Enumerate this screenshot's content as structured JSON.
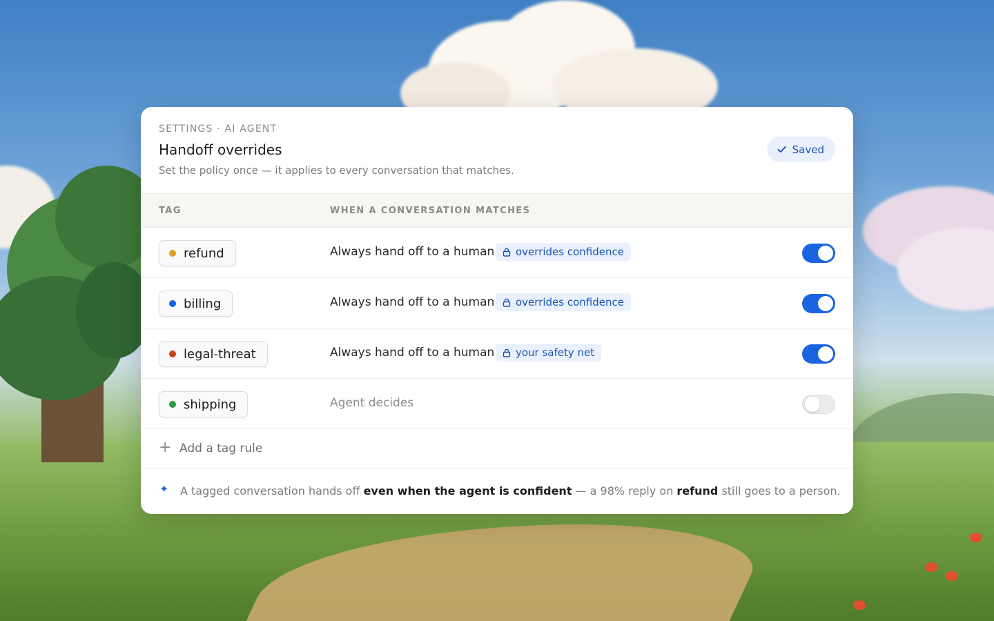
{
  "card": {
    "eyebrow": "SETTINGS · AI AGENT",
    "title": "Handoff overrides",
    "subtitle": "Set the policy once — it applies to every conversation that matches.",
    "status": {
      "label": "Saved",
      "icon": "check-icon"
    }
  },
  "table": {
    "columns": [
      "TAG",
      "WHEN A CONVERSATION MATCHES"
    ],
    "rows": [
      {
        "tag": "refund",
        "dot_color": "#e0a12b",
        "rule": "Always hand off to a human",
        "badge": "overrides confidence",
        "badge_icon": "lock-icon",
        "enabled": true
      },
      {
        "tag": "billing",
        "dot_color": "#1b64e0",
        "rule": "Always hand off to a human",
        "badge": "overrides confidence",
        "badge_icon": "lock-icon",
        "enabled": true
      },
      {
        "tag": "legal-threat",
        "dot_color": "#c8431c",
        "rule": "Always hand off to a human",
        "badge": "your safety net",
        "badge_icon": "lock-icon",
        "enabled": true
      },
      {
        "tag": "shipping",
        "dot_color": "#2e9a43",
        "rule": "Agent decides",
        "badge": "",
        "enabled": false
      }
    ],
    "add_rule_label": "Add a tag rule"
  },
  "footer": {
    "icon": "sparkle-icon",
    "part1": "A tagged conversation hands off ",
    "bold1": "even when the agent is confident",
    "part2": " — a 98% reply on ",
    "bold2": "refund",
    "part3": " still goes to a person."
  },
  "colors": {
    "accent": "#1b64e0",
    "badge_bg": "#eaf1fc"
  }
}
